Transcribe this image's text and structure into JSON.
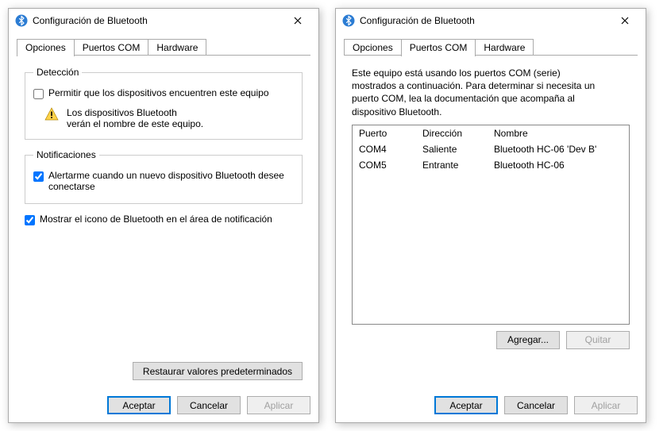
{
  "dialogs": {
    "left": {
      "title": "Configuración de Bluetooth",
      "tabs": {
        "options": "Opciones",
        "com": "Puertos COM",
        "hw": "Hardware"
      },
      "detection": {
        "legend": "Detección",
        "allow_label": "Permitir que los dispositivos encuentren este equipo",
        "allow_checked": false,
        "warn_text": "Los dispositivos Bluetooth\nverán el nombre de este equipo."
      },
      "notifications": {
        "legend": "Notificaciones",
        "alert_label": "Alertarme cuando un nuevo dispositivo Bluetooth desee conectarse",
        "alert_checked": true
      },
      "tray_label": "Mostrar el icono de Bluetooth en el área de notificación",
      "tray_checked": true,
      "restore_defaults": "Restaurar valores predeterminados",
      "buttons": {
        "ok": "Aceptar",
        "cancel": "Cancelar",
        "apply": "Aplicar"
      }
    },
    "right": {
      "title": "Configuración de Bluetooth",
      "tabs": {
        "options": "Opciones",
        "com": "Puertos COM",
        "hw": "Hardware"
      },
      "description": "Este equipo está usando los puertos COM (serie) mostrados a continuación. Para determinar si necesita un puerto COM, lea la documentación que acompaña al dispositivo Bluetooth.",
      "headers": {
        "port": "Puerto",
        "dir": "Dirección",
        "name": "Nombre"
      },
      "rows": [
        {
          "port": "COM4",
          "dir": "Saliente",
          "name": "Bluetooth HC-06 'Dev B'"
        },
        {
          "port": "COM5",
          "dir": "Entrante",
          "name": "Bluetooth HC-06"
        }
      ],
      "add": "Agregar...",
      "remove": "Quitar",
      "buttons": {
        "ok": "Aceptar",
        "cancel": "Cancelar",
        "apply": "Aplicar"
      }
    }
  }
}
